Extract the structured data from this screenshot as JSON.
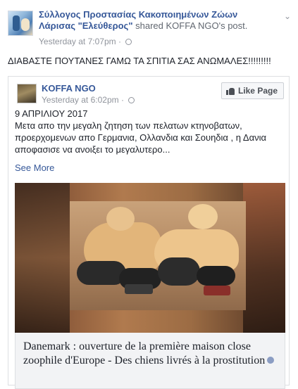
{
  "share": {
    "page_name": "Σύλλογος Προστασίας Κακοποιημένων Ζώων Λάρισας \"Ελεύθερος\"",
    "action": "shared",
    "shared_from": "KOFFA NGO",
    "shared_suffix": "'s post.",
    "timestamp": "Yesterday at 7:07pm",
    "separator": "·",
    "text": "ΔΙΑΒΑΣΤΕ ΠΟΥΤΑΝΕΣ ΓΑΜΩ ΤΑ ΣΠΙΤΙΑ ΣΑΣ ΑΝΩΜΑΛΕΣ!!!!!!!!!"
  },
  "original": {
    "page_name": "KOFFA NGO",
    "timestamp": "Yesterday at 6:02pm",
    "separator": "·",
    "like_label": "Like Page",
    "date": "9 ΑΠΡΙΛΙΟΥ 2017",
    "body": "Μετα απο την μεγαλη ζητηση των πελατων κτηνοβατων, προερχομενων απο Γερμανια, Ολλανδια και Σουηδια , η Δανια αποφασισε να ανοιξει το μεγαλυτερο...",
    "see_more": "See More"
  },
  "link_preview": {
    "title": "Danemark : ouverture de la première maison close zoophile d'Europe - Des chiens livrés à la prostitution"
  },
  "icons": [
    "globe-icon",
    "chevron-down-icon",
    "thumbs-up-icon",
    "verified-icon"
  ]
}
